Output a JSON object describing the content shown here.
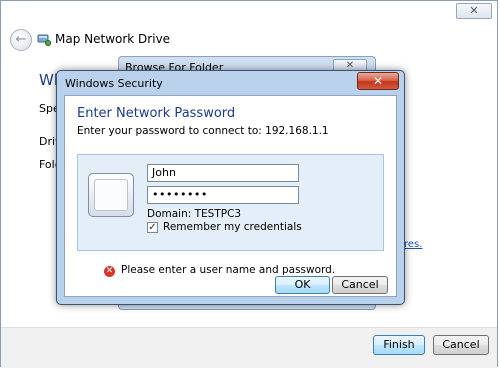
{
  "wizard": {
    "title": "Map Network Drive",
    "heading": "Wh",
    "spec_label": "Spec",
    "drive_label": "Drive",
    "folder_label": "Fold",
    "link_fragment": "res.",
    "close_glyph": "✕",
    "back_glyph": "←",
    "finish_label": "Finish",
    "cancel_label": "Cancel"
  },
  "browse": {
    "title": "Browse For Folder",
    "close_glyph": "✕"
  },
  "security": {
    "title": "Windows Security",
    "close_glyph": "✕",
    "heading": "Enter Network Password",
    "subtitle": "Enter your password to connect to: 192.168.1.1",
    "username_value": "John",
    "password_value": "••••••••",
    "domain_text": "Domain: TESTPC3",
    "remember_label": "Remember my credentials",
    "remember_checked": "✓",
    "error_glyph": "✕",
    "error_text": "Please enter a user name and password.",
    "ok_label": "OK",
    "cancel_label": "Cancel"
  },
  "icons": {
    "app": "network-drive-icon",
    "user_tile": "user-tile-icon",
    "error": "error-icon"
  }
}
